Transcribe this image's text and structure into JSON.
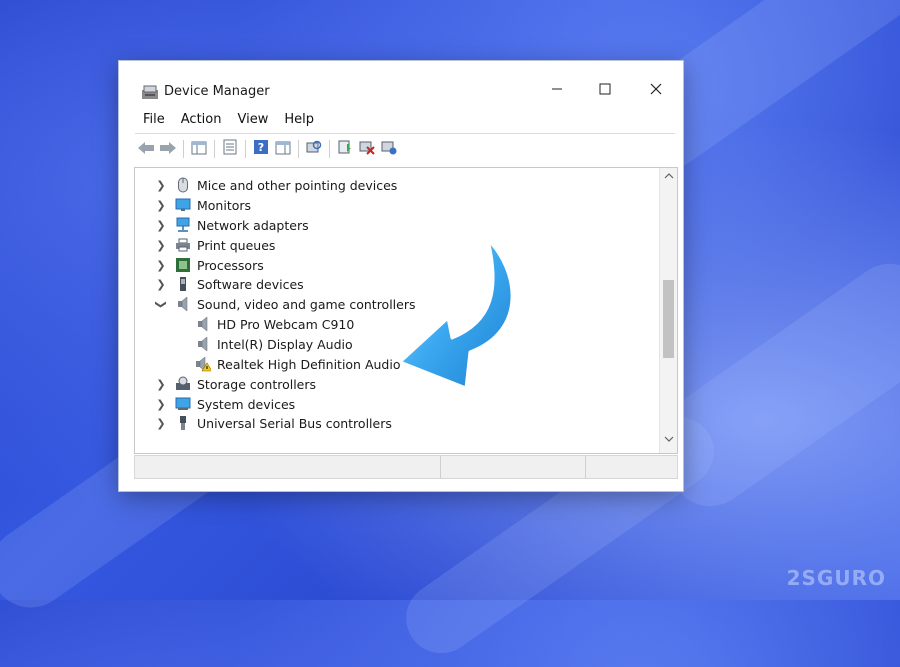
{
  "window": {
    "title": "Device Manager",
    "controls": {
      "minimize": "—",
      "maximize": "□",
      "close": "✕"
    }
  },
  "menu": [
    "File",
    "Action",
    "View",
    "Help"
  ],
  "toolbar": {
    "icons": [
      "back-arrow-icon",
      "forward-arrow-icon",
      "show-hide-console-tree-icon",
      "properties-icon",
      "help-icon",
      "show-hide-action-pane-icon",
      "scan-hardware-icon",
      "update-driver-icon",
      "disable-device-icon",
      "uninstall-device-icon"
    ]
  },
  "tree": {
    "items": [
      {
        "label": "Mice and other pointing devices",
        "expanded": false,
        "icon": "mouse-icon"
      },
      {
        "label": "Monitors",
        "expanded": false,
        "icon": "monitor-icon"
      },
      {
        "label": "Network adapters",
        "expanded": false,
        "icon": "network-adapter-icon"
      },
      {
        "label": "Print queues",
        "expanded": false,
        "icon": "printer-icon"
      },
      {
        "label": "Processors",
        "expanded": false,
        "icon": "processor-icon"
      },
      {
        "label": "Software devices",
        "expanded": false,
        "icon": "software-device-icon"
      },
      {
        "label": "Sound, video and game controllers",
        "expanded": true,
        "icon": "speaker-icon",
        "children": [
          {
            "label": "HD Pro Webcam C910",
            "icon": "speaker-icon"
          },
          {
            "label": "Intel(R) Display Audio",
            "icon": "speaker-icon"
          },
          {
            "label": "Realtek High Definition Audio",
            "icon": "speaker-warning-icon",
            "warning": true
          }
        ]
      },
      {
        "label": "Storage controllers",
        "expanded": false,
        "icon": "storage-controller-icon"
      },
      {
        "label": "System devices",
        "expanded": false,
        "icon": "system-device-icon"
      },
      {
        "label": "Universal Serial Bus controllers",
        "expanded": false,
        "icon": "usb-icon"
      }
    ]
  },
  "scrollbar": {
    "position_fraction": 0.45
  },
  "watermark": "2SGURO",
  "colors": {
    "callout_arrow": "#3aa8f0",
    "warning": "#f5c518",
    "accent": "#2b6fd6"
  }
}
